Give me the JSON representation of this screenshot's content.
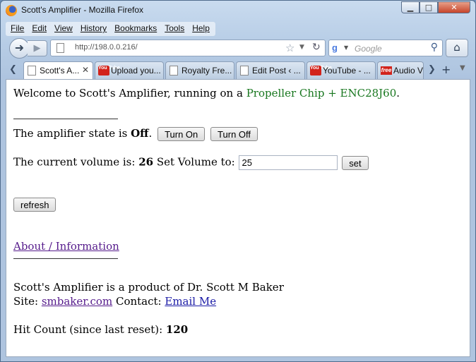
{
  "window": {
    "title": "Scott's Amplifier - Mozilla Firefox",
    "controls": {
      "minimize": "▁",
      "maximize": "□",
      "close": "✕"
    }
  },
  "menu": {
    "items": [
      {
        "label": "File"
      },
      {
        "label": "Edit"
      },
      {
        "label": "View"
      },
      {
        "label": "History"
      },
      {
        "label": "Bookmarks"
      },
      {
        "label": "Tools"
      },
      {
        "label": "Help"
      }
    ]
  },
  "navigation": {
    "url": "http://198.0.0.216/",
    "search_placeholder": "Google"
  },
  "tabs": [
    {
      "label": "Scott's A...",
      "icon": "page-icon",
      "active": true
    },
    {
      "label": "Upload you...",
      "icon": "youtube-icon"
    },
    {
      "label": "Royalty Fre...",
      "icon": "page-icon"
    },
    {
      "label": "Edit Post ‹ ...",
      "icon": "page-icon"
    },
    {
      "label": "YouTube - ...",
      "icon": "youtube-icon"
    },
    {
      "label": "Audio V",
      "icon": "freesound-icon"
    }
  ],
  "icon_text": {
    "youtube": "You Tube",
    "freesound": "free"
  },
  "page": {
    "welcome_prefix": "Welcome to Scott's Amplifier, running on a ",
    "welcome_highlight": "Propeller Chip + ENC28J60",
    "welcome_suffix": ".",
    "amp_state_prefix": "The amplifier state is ",
    "amp_state_value": "Off",
    "amp_state_suffix": ".",
    "turn_on_label": "Turn On",
    "turn_off_label": "Turn Off",
    "volume_prefix": "The current volume is: ",
    "volume_value": "26",
    "set_volume_label": " Set Volume to: ",
    "volume_input_value": "25",
    "set_button_label": "set",
    "refresh_label": "refresh",
    "about_link": "About / Information",
    "product_line": "Scott's Amplifier is a product of Dr. Scott M Baker",
    "site_label": "Site: ",
    "site_link": "smbaker.com",
    "contact_label": " Contact: ",
    "contact_link": "Email Me",
    "hit_count_label": "Hit Count (since last reset): ",
    "hit_count_value": "120"
  },
  "colors": {
    "highlight": "#18771f",
    "visited_link": "#551a8b",
    "link": "#1a1aa6"
  }
}
